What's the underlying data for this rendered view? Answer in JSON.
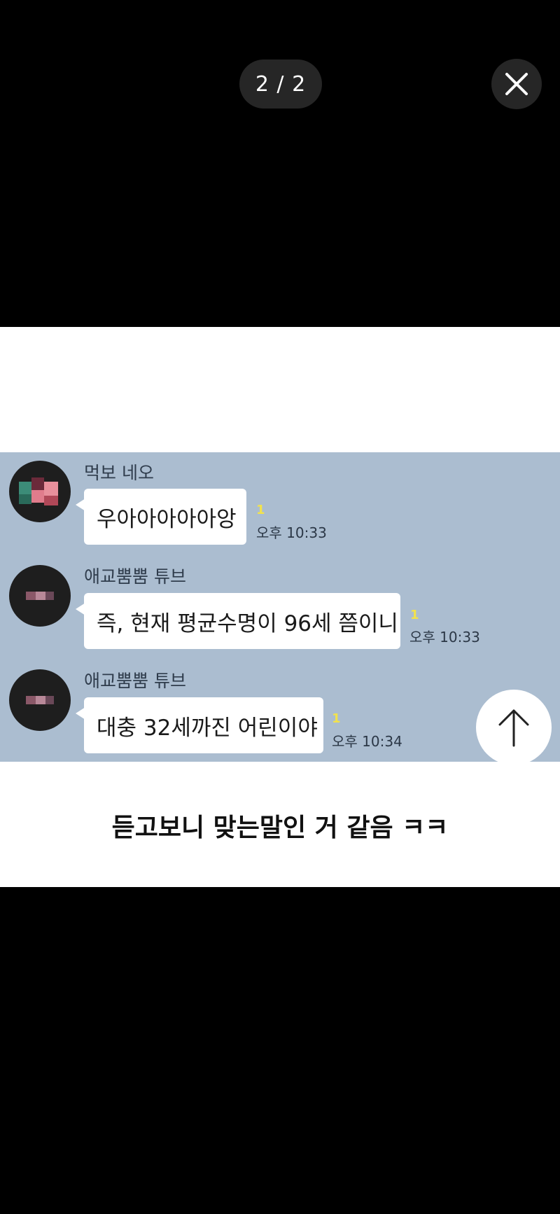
{
  "viewer": {
    "counter": "2 / 2"
  },
  "chat": {
    "messages": [
      {
        "sender": "먹보 네오",
        "text": "우아아아아아앙",
        "unread": "1",
        "time": "오후 10:33"
      },
      {
        "sender": "애교뿜뿜 튜브",
        "text": "즉, 현재 평균수명이 96세 쯤이니",
        "unread": "1",
        "time": "오후 10:33"
      },
      {
        "sender": "애교뿜뿜 튜브",
        "text": "대충 32세까진 어린이야",
        "unread": "1",
        "time": "오후 10:34"
      }
    ]
  },
  "caption": "듣고보니 맞는말인 거 같음 ㅋㅋ",
  "colors": {
    "chat_background": "#abbdd0",
    "unread_badge": "#f2e24c",
    "overlay_button": "#262626"
  }
}
